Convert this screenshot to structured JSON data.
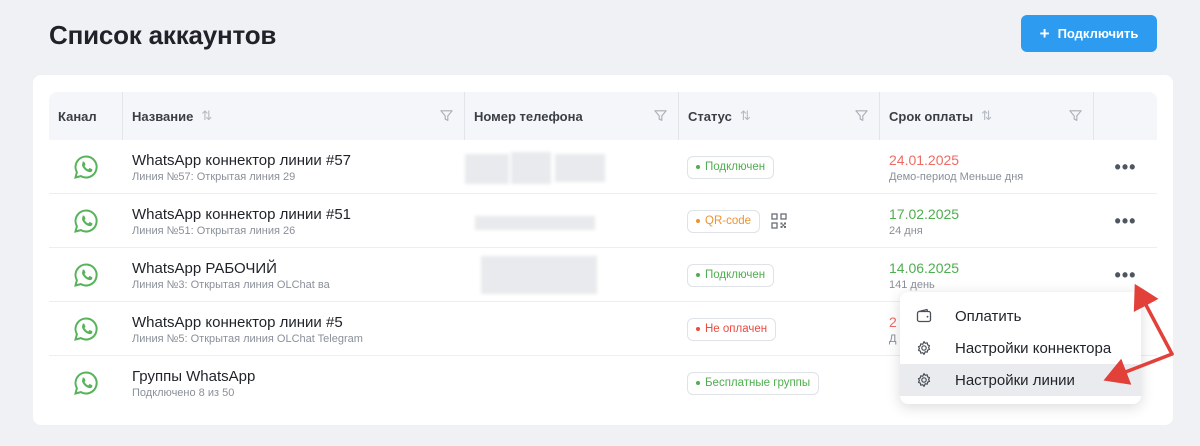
{
  "header": {
    "title": "Список аккаунтов",
    "connect_label": "Подключить",
    "connect_icon": "plus-icon"
  },
  "columns": {
    "channel": "Канал",
    "name": "Название",
    "phone": "Номер телефона",
    "status": "Статус",
    "payment": "Срок оплаты"
  },
  "rows": [
    {
      "name": "WhatsApp коннектор линии #57",
      "sub": "Линия №57: Открытая линия 29",
      "status": "Подключен",
      "status_kind": "ok",
      "date": "24.01.2025",
      "date_sub": "Демо-период Меньше дня",
      "date_color": "red"
    },
    {
      "name": "WhatsApp коннектор линии #51",
      "sub": "Линия №51: Открытая линия 26",
      "status": "QR-code",
      "status_kind": "warn",
      "date": "17.02.2025",
      "date_sub": "24 дня",
      "date_color": "green"
    },
    {
      "name": "WhatsApp РАБОЧИЙ",
      "sub": "Линия №3: Открытая линия OLChat ва",
      "status": "Подключен",
      "status_kind": "ok",
      "date": "14.06.2025",
      "date_sub": "141 день",
      "date_color": "green"
    },
    {
      "name": "WhatsApp коннектор линии #5",
      "sub": "Линия №5: Открытая линия OLChat Telegram",
      "status": "Не оплачен",
      "status_kind": "err",
      "date": "2",
      "date_sub": "Д",
      "date_color": "red"
    },
    {
      "name": "Группы WhatsApp",
      "sub": "Подключено 8 из 50",
      "status": "Бесплатные группы",
      "status_kind": "ok",
      "date": "",
      "date_sub": "",
      "date_color": "green"
    }
  ],
  "row_menu_label": "•••",
  "context_menu": {
    "items": [
      {
        "label": "Оплатить",
        "icon": "wallet-icon"
      },
      {
        "label": "Настройки коннектора",
        "icon": "gear-icon"
      },
      {
        "label": "Настройки линии",
        "icon": "gear-icon",
        "highlighted": true
      }
    ]
  },
  "colors": {
    "accent": "#2d9cf0",
    "whatsapp": "#56b35a",
    "ok": "#4fae4f",
    "warn": "#f0922e",
    "err": "#ee4a3f",
    "annotation_arrow": "#e2413a"
  }
}
